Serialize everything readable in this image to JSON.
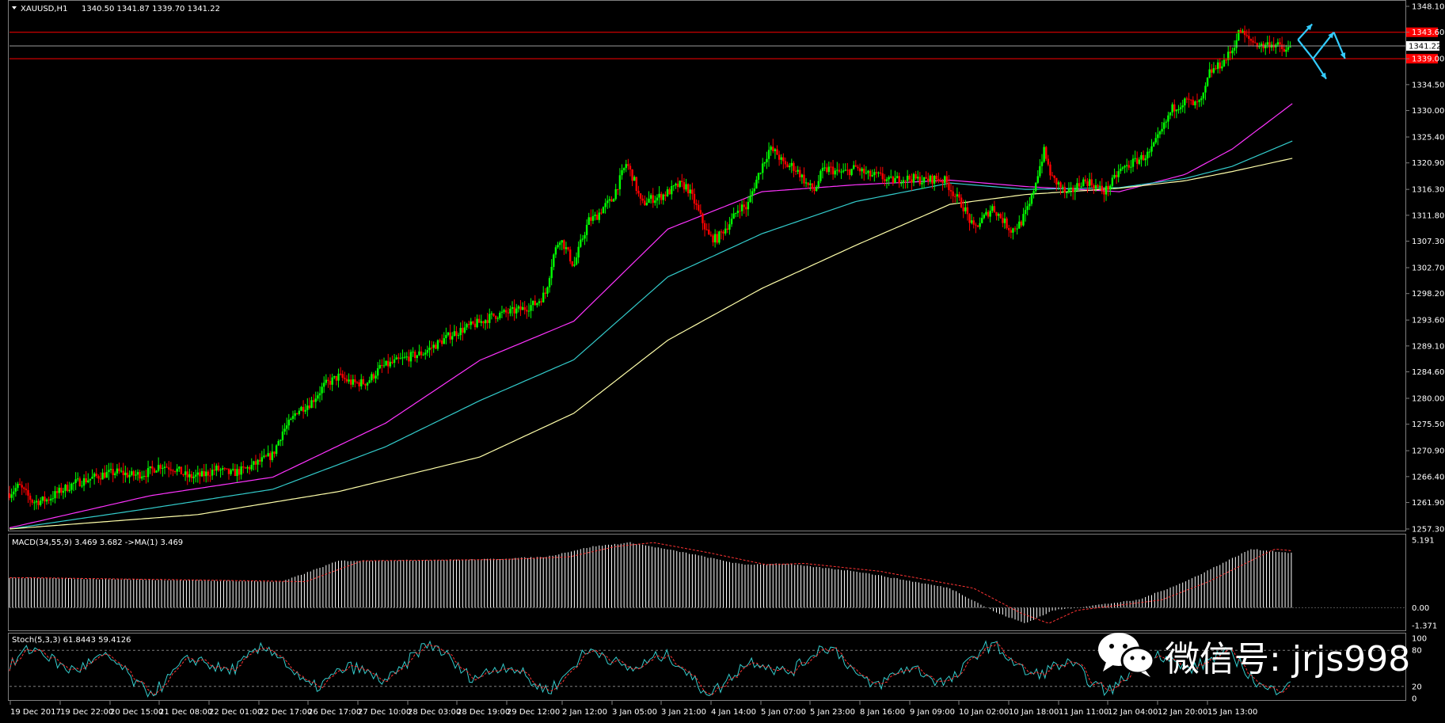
{
  "header": {
    "symbol": "XAUUSD,H1",
    "ohlc": "1340.50 1341.87 1339.70 1341.22"
  },
  "indicators": {
    "macd_label": "MACD(34,55,9) 3.469 3.682  ->MA(1) 3.469",
    "stoch_label": "Stoch(5,3,3) 61.8443 59.4126"
  },
  "watermark": {
    "text": "微信号: jrjs998",
    "icon": "wechat-icon"
  },
  "colors": {
    "background": "#000000",
    "bull_candle": "#00ff00",
    "bear_candle": "#ff0000",
    "ma_fast": "#ff33ff",
    "ma_mid": "#33cccc",
    "ma_slow": "#ffffaa",
    "level_line": "#ff0000",
    "arrow": "#33ccff"
  },
  "chart_data": {
    "type": "candlestick",
    "symbol": "XAUUSD",
    "timeframe": "H1",
    "ylim": [
      1257.3,
      1348.1
    ],
    "y_ticks": [
      "1348.10",
      "1343.60",
      "1339.00",
      "1334.50",
      "1330.00",
      "1325.40",
      "1320.90",
      "1316.30",
      "1311.80",
      "1307.30",
      "1302.70",
      "1298.20",
      "1293.60",
      "1289.10",
      "1284.60",
      "1280.00",
      "1275.50",
      "1270.90",
      "1266.40",
      "1261.90",
      "1257.30"
    ],
    "x_ticks": [
      "19 Dec 2017",
      "19 Dec 22:00",
      "20 Dec 15:00",
      "21 Dec 08:00",
      "22 Dec 01:00",
      "22 Dec 17:00",
      "26 Dec 17:00",
      "27 Dec 10:00",
      "28 Dec 03:00",
      "28 Dec 19:00",
      "29 Dec 12:00",
      "2 Jan 12:00",
      "3 Jan 05:00",
      "3 Jan 21:00",
      "4 Jan 14:00",
      "5 Jan 07:00",
      "5 Jan 23:00",
      "8 Jan 16:00",
      "9 Jan 09:00",
      "10 Jan 02:00",
      "10 Jan 18:00",
      "11 Jan 11:00",
      "12 Jan 04:00",
      "12 Jan 20:00",
      "15 Jan 13:00"
    ],
    "price_path": [
      [
        0,
        1263.5
      ],
      [
        10,
        1264.8
      ],
      [
        25,
        1262
      ],
      [
        40,
        1262.4
      ],
      [
        55,
        1264
      ],
      [
        70,
        1265.3
      ],
      [
        85,
        1266
      ],
      [
        100,
        1266.8
      ],
      [
        115,
        1267.2
      ],
      [
        130,
        1266.6
      ],
      [
        145,
        1267
      ],
      [
        160,
        1268.4
      ],
      [
        175,
        1267.9
      ],
      [
        190,
        1266.3
      ],
      [
        205,
        1266.6
      ],
      [
        220,
        1267.7
      ],
      [
        235,
        1266.9
      ],
      [
        250,
        1267.6
      ],
      [
        265,
        1268.9
      ],
      [
        280,
        1270.2
      ],
      [
        290,
        1274.2
      ],
      [
        300,
        1276.1
      ],
      [
        305,
        1277.8
      ],
      [
        320,
        1279.2
      ],
      [
        335,
        1282.3
      ],
      [
        350,
        1283.8
      ],
      [
        365,
        1282.6
      ],
      [
        380,
        1282.8
      ],
      [
        395,
        1285.4
      ],
      [
        410,
        1286.3
      ],
      [
        425,
        1287.2
      ],
      [
        440,
        1287.9
      ],
      [
        455,
        1289.5
      ],
      [
        470,
        1291.1
      ],
      [
        485,
        1292.2
      ],
      [
        500,
        1293.2
      ],
      [
        515,
        1294.4
      ],
      [
        530,
        1294.9
      ],
      [
        545,
        1295.5
      ],
      [
        560,
        1296.5
      ],
      [
        570,
        1298.3
      ],
      [
        578,
        1304.6
      ],
      [
        585,
        1307.9
      ],
      [
        592,
        1305.9
      ],
      [
        600,
        1302.9
      ],
      [
        608,
        1307.3
      ],
      [
        616,
        1310.9
      ],
      [
        624,
        1311.6
      ],
      [
        632,
        1313.3
      ],
      [
        640,
        1314.3
      ],
      [
        648,
        1317.6
      ],
      [
        656,
        1320.9
      ],
      [
        664,
        1317.9
      ],
      [
        672,
        1313.6
      ],
      [
        680,
        1314.6
      ],
      [
        688,
        1314.8
      ],
      [
        696,
        1315.4
      ],
      [
        704,
        1316.2
      ],
      [
        712,
        1317.1
      ],
      [
        720,
        1316.8
      ],
      [
        728,
        1314.2
      ],
      [
        736,
        1311
      ],
      [
        744,
        1308
      ],
      [
        752,
        1307.7
      ],
      [
        760,
        1309.4
      ],
      [
        768,
        1310.9
      ],
      [
        776,
        1313.3
      ],
      [
        784,
        1313.1
      ],
      [
        792,
        1317
      ],
      [
        800,
        1320.4
      ],
      [
        808,
        1323.3
      ],
      [
        816,
        1322.5
      ],
      [
        824,
        1320.4
      ],
      [
        832,
        1320.4
      ],
      [
        840,
        1319.1
      ],
      [
        848,
        1317.1
      ],
      [
        856,
        1316.1
      ],
      [
        864,
        1319.4
      ],
      [
        872,
        1319.9
      ],
      [
        880,
        1319.2
      ],
      [
        890,
        1319.3
      ],
      [
        900,
        1320.1
      ],
      [
        912,
        1318.8
      ],
      [
        925,
        1318.6
      ],
      [
        935,
        1317.7
      ],
      [
        948,
        1318.2
      ],
      [
        960,
        1318.2
      ],
      [
        972,
        1317.8
      ],
      [
        985,
        1318.2
      ],
      [
        995,
        1317.8
      ],
      [
        1005,
        1315.3
      ],
      [
        1015,
        1313.1
      ],
      [
        1025,
        1309.4
      ],
      [
        1035,
        1311.2
      ],
      [
        1045,
        1313.2
      ],
      [
        1055,
        1311.2
      ],
      [
        1065,
        1309.2
      ],
      [
        1075,
        1310.4
      ],
      [
        1085,
        1313.7
      ],
      [
        1092,
        1318.3
      ],
      [
        1100,
        1322.9
      ],
      [
        1108,
        1318.3
      ],
      [
        1116,
        1317.1
      ],
      [
        1124,
        1315.3
      ],
      [
        1132,
        1316.3
      ],
      [
        1140,
        1317.7
      ],
      [
        1148,
        1317.6
      ],
      [
        1156,
        1316.7
      ],
      [
        1164,
        1315.9
      ],
      [
        1172,
        1317.4
      ],
      [
        1180,
        1319.5
      ],
      [
        1188,
        1320.3
      ],
      [
        1196,
        1321.1
      ],
      [
        1204,
        1321.8
      ],
      [
        1212,
        1322.5
      ],
      [
        1220,
        1324.8
      ],
      [
        1228,
        1327.4
      ],
      [
        1236,
        1330.3
      ],
      [
        1244,
        1331.1
      ],
      [
        1252,
        1331.7
      ],
      [
        1260,
        1330.9
      ],
      [
        1268,
        1331.6
      ],
      [
        1276,
        1336.6
      ],
      [
        1284,
        1337.5
      ],
      [
        1292,
        1338.7
      ],
      [
        1300,
        1340.5
      ],
      [
        1308,
        1343.9
      ],
      [
        1316,
        1342.5
      ],
      [
        1324,
        1341.8
      ],
      [
        1332,
        1341.1
      ],
      [
        1340,
        1341.7
      ],
      [
        1348,
        1341.3
      ],
      [
        1356,
        1340.2
      ],
      [
        1364,
        1341.2
      ]
    ],
    "moving_averages": [
      {
        "name": "MA magenta",
        "points": [
          [
            0,
            1257.5
          ],
          [
            150,
            1263.1
          ],
          [
            280,
            1266.3
          ],
          [
            400,
            1275.7
          ],
          [
            500,
            1286.6
          ],
          [
            600,
            1293.4
          ],
          [
            700,
            1309.4
          ],
          [
            800,
            1315.9
          ],
          [
            900,
            1317.1
          ],
          [
            1000,
            1317.9
          ],
          [
            1080,
            1316.8
          ],
          [
            1180,
            1315.9
          ],
          [
            1250,
            1318.9
          ],
          [
            1300,
            1323.3
          ],
          [
            1364,
            1331.2
          ]
        ]
      },
      {
        "name": "MA cyan",
        "points": [
          [
            0,
            1257.3
          ],
          [
            150,
            1260.9
          ],
          [
            280,
            1264.2
          ],
          [
            400,
            1271.6
          ],
          [
            500,
            1279.6
          ],
          [
            600,
            1286.7
          ],
          [
            700,
            1301.1
          ],
          [
            800,
            1308.6
          ],
          [
            900,
            1314.2
          ],
          [
            1000,
            1317.4
          ],
          [
            1080,
            1316.3
          ],
          [
            1180,
            1316.6
          ],
          [
            1250,
            1318.2
          ],
          [
            1300,
            1320.3
          ],
          [
            1364,
            1324.7
          ]
        ]
      },
      {
        "name": "MA light yellow",
        "points": [
          [
            0,
            1257.3
          ],
          [
            200,
            1259.8
          ],
          [
            350,
            1263.8
          ],
          [
            500,
            1269.8
          ],
          [
            600,
            1277.4
          ],
          [
            700,
            1290.1
          ],
          [
            800,
            1299.1
          ],
          [
            900,
            1306.6
          ],
          [
            1000,
            1313.7
          ],
          [
            1080,
            1315.4
          ],
          [
            1180,
            1316.5
          ],
          [
            1250,
            1317.8
          ],
          [
            1300,
            1319.4
          ],
          [
            1364,
            1321.7
          ]
        ]
      }
    ],
    "horizontal_levels": [
      1343.6,
      1339.0
    ],
    "current_price": 1341.22,
    "annotation_arrows": [
      [
        [
          1370,
          1342.3
        ],
        [
          1385,
          1345.0
        ]
      ],
      [
        [
          1370,
          1342.3
        ],
        [
          1386,
          1339.0
        ],
        [
          1400,
          1335.5
        ]
      ],
      [
        [
          1386,
          1339.0
        ],
        [
          1408,
          1343.6
        ]
      ],
      [
        [
          1408,
          1343.6
        ],
        [
          1420,
          1339.0
        ]
      ]
    ],
    "macd": {
      "ylim": [
        -1.371,
        5.191
      ],
      "y_ticks": [
        "5.191",
        "0.00",
        "-1.371"
      ],
      "histogram_path": [
        [
          0,
          2.3
        ],
        [
          200,
          2.1
        ],
        [
          290,
          2.0
        ],
        [
          350,
          3.6
        ],
        [
          500,
          3.7
        ],
        [
          570,
          3.9
        ],
        [
          620,
          4.7
        ],
        [
          660,
          5.0
        ],
        [
          720,
          4.2
        ],
        [
          780,
          3.3
        ],
        [
          820,
          3.4
        ],
        [
          900,
          2.8
        ],
        [
          1000,
          1.5
        ],
        [
          1050,
          -0.4
        ],
        [
          1080,
          -1.2
        ],
        [
          1110,
          -0.2
        ],
        [
          1200,
          0.6
        ],
        [
          1250,
          2.0
        ],
        [
          1320,
          4.5
        ],
        [
          1364,
          4.2
        ]
      ]
    },
    "stochastic": {
      "ylim": [
        0,
        100
      ],
      "y_ticks": [
        "100",
        "80",
        "20",
        "0"
      ],
      "levels": [
        80,
        20
      ]
    }
  }
}
